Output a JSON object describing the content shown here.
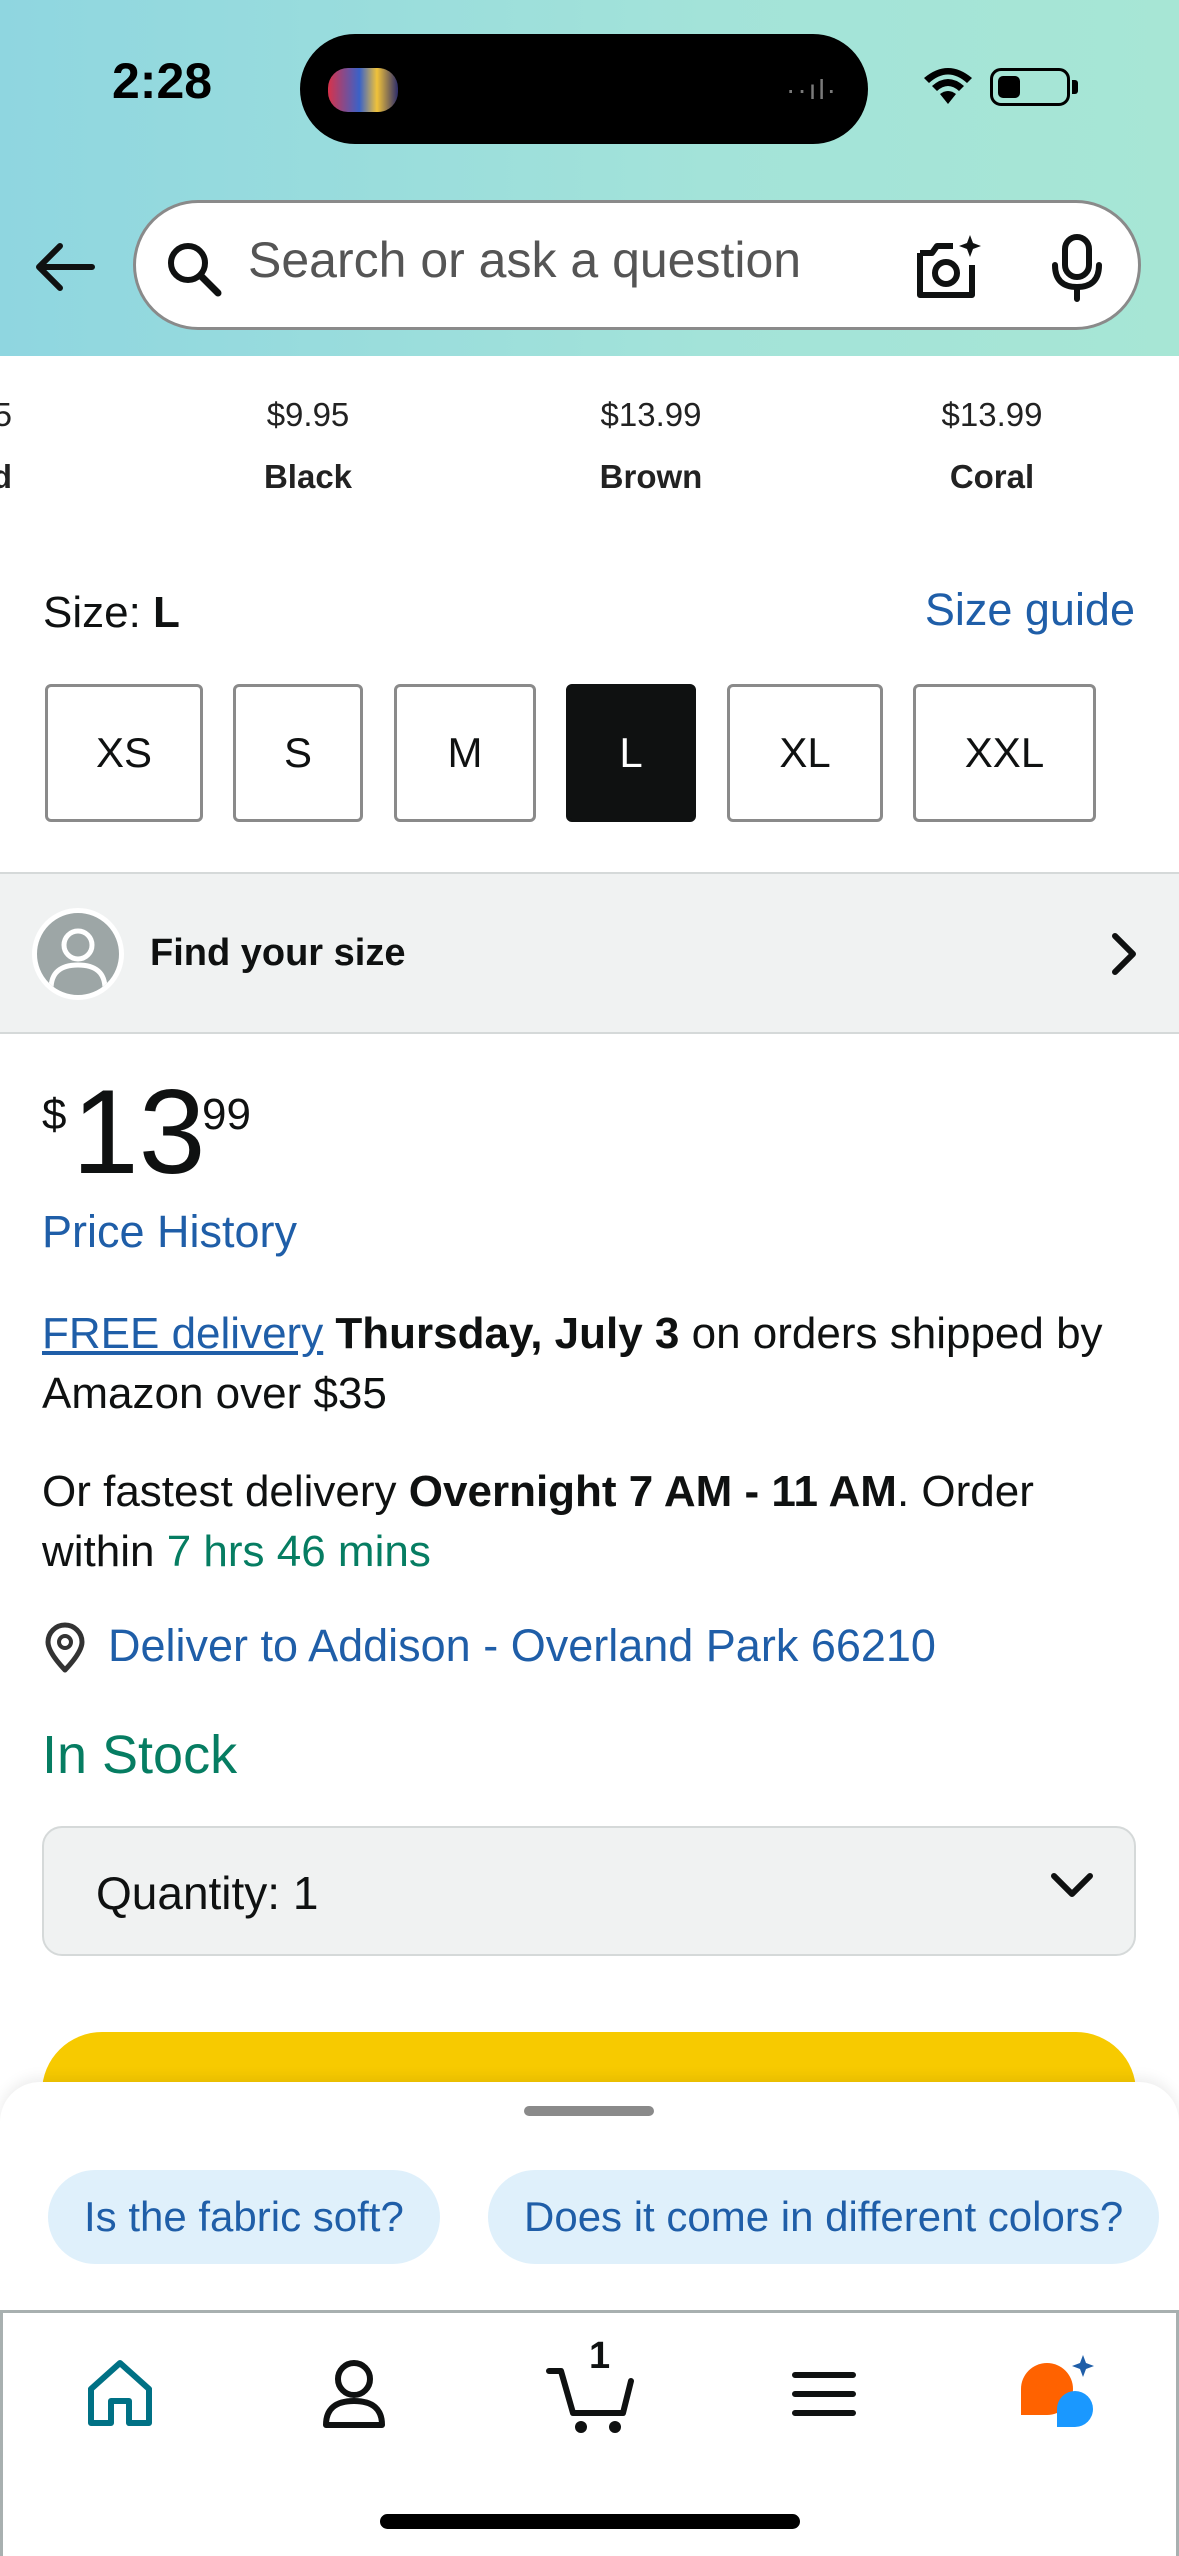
{
  "status_bar": {
    "time": "2:28"
  },
  "search": {
    "placeholder": "Search or ask a question"
  },
  "color_options": [
    {
      "price": "5",
      "name": "ed"
    },
    {
      "price": "$9.95",
      "name": "Black"
    },
    {
      "price": "$13.99",
      "name": "Brown"
    },
    {
      "price": "$13.99",
      "name": "Coral"
    }
  ],
  "size": {
    "label": "Size: ",
    "selected": "L",
    "guide": "Size guide",
    "options": [
      "XS",
      "S",
      "M",
      "L",
      "XL",
      "XXL"
    ]
  },
  "find_size": {
    "label": "Find your size"
  },
  "price": {
    "symbol": "$",
    "whole": "13",
    "fraction": "99",
    "history": "Price History"
  },
  "delivery": {
    "free_link": "FREE delivery",
    "date": "Thursday, July 3",
    "rest": " on orders shipped by Amazon over $35",
    "fast_prefix": "Or fastest delivery ",
    "fast_window": "Overnight 7 AM - 11 AM",
    "fast_mid": ". Order within ",
    "countdown": "7 hrs 46 mins",
    "deliver_to": "Deliver to Addison - Overland Park 66210"
  },
  "stock": "In Stock",
  "quantity": {
    "label": "Quantity:",
    "value": "1"
  },
  "suggestions": [
    "Is the fabric soft?",
    "Does it come in different colors?"
  ],
  "nav": {
    "cart_count": "1",
    "active": "home"
  },
  "colors": {
    "link": "#1f5ea8",
    "green": "#067d62",
    "buy": "#f7ca00",
    "home_active": "#007185"
  }
}
